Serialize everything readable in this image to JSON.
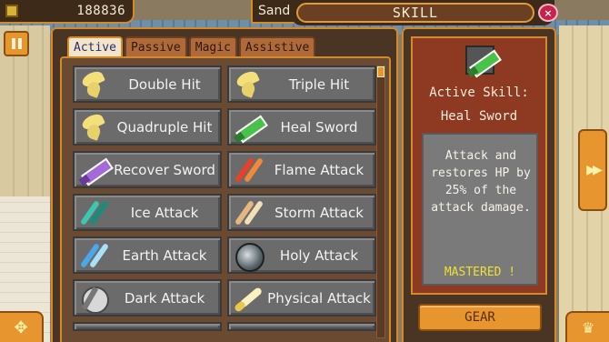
{
  "header": {
    "gold": "188836",
    "location": "Sanda",
    "title": "SKILL"
  },
  "tabs": [
    {
      "label": "Active",
      "active": true
    },
    {
      "label": "Passive",
      "active": false
    },
    {
      "label": "Magic",
      "active": false
    },
    {
      "label": "Assistive",
      "active": false
    }
  ],
  "skills": [
    {
      "label": "Double Hit",
      "icon": "claw-icon"
    },
    {
      "label": "Triple Hit",
      "icon": "claw-icon"
    },
    {
      "label": "Quadruple Hit",
      "icon": "claw-icon"
    },
    {
      "label": "Heal Sword",
      "icon": "green-sword-icon"
    },
    {
      "label": "Recover Sword",
      "icon": "purple-sword-icon"
    },
    {
      "label": "Flame Attack",
      "icon": "flame-slash-icon"
    },
    {
      "label": "Ice Attack",
      "icon": "ice-slash-icon"
    },
    {
      "label": "Storm Attack",
      "icon": "storm-slash-icon"
    },
    {
      "label": "Earth Attack",
      "icon": "earth-slash-icon"
    },
    {
      "label": "Holy Attack",
      "icon": "holy-orb-icon"
    },
    {
      "label": "Dark Attack",
      "icon": "dark-orb-icon"
    },
    {
      "label": "Physical Attack",
      "icon": "physical-slash-icon"
    }
  ],
  "detail": {
    "heading_line1": "Active Skill:",
    "heading_line2": "Heal Sword",
    "description": "Attack and restores HP by 25% of the attack damage.",
    "status": "MASTERED !",
    "icon": "green-sword-icon"
  },
  "buttons": {
    "gear": "GEAR",
    "close": "×",
    "pause": "pause-icon",
    "next": "double-arrow-right-icon",
    "dpad": "dpad-icon",
    "crown": "crown-icon"
  },
  "colors": {
    "accent": "#d48a2a",
    "panel": "#4a3424",
    "detail_bg": "#8e3a22",
    "mastered": "#f0e030"
  }
}
